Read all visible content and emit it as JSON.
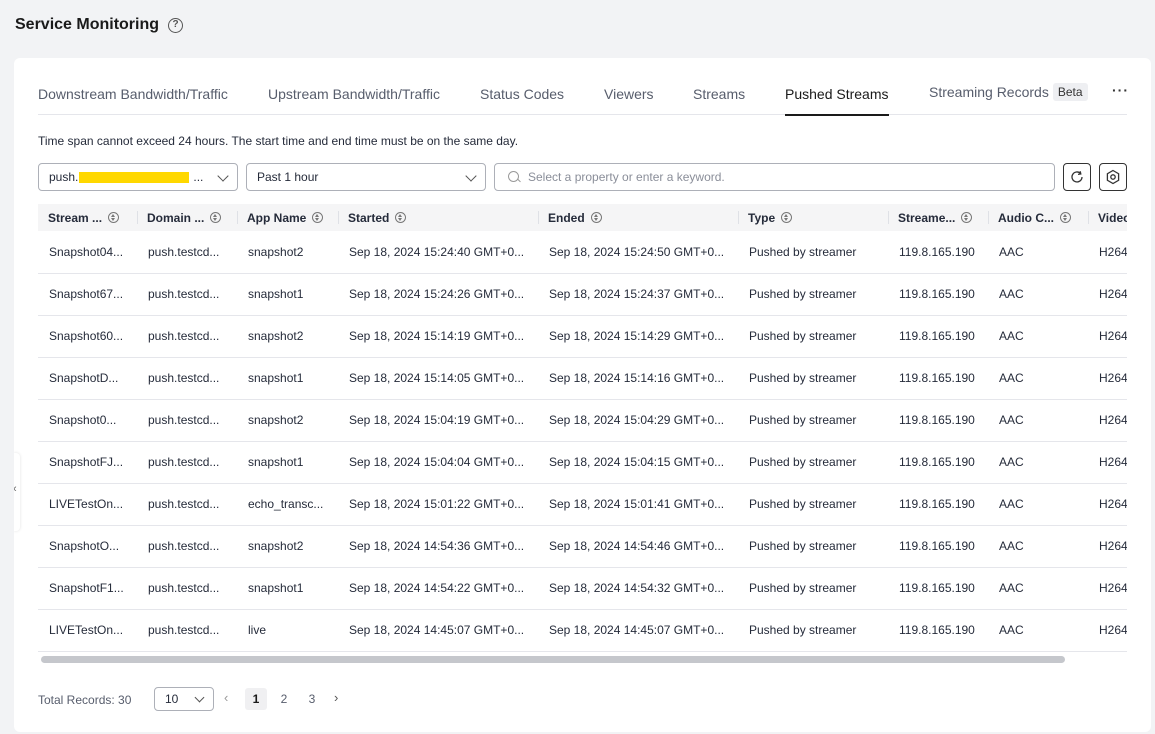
{
  "header": {
    "title": "Service Monitoring"
  },
  "tabs": [
    {
      "label": "Downstream Bandwidth/Traffic"
    },
    {
      "label": "Upstream Bandwidth/Traffic"
    },
    {
      "label": "Status Codes"
    },
    {
      "label": "Viewers"
    },
    {
      "label": "Streams"
    },
    {
      "label": "Pushed Streams",
      "active": true
    },
    {
      "label": "Streaming Records",
      "badge": "Beta"
    }
  ],
  "more_label": "···",
  "notice": "Time span cannot exceed 24 hours. The start time and end time must be on the same day.",
  "filters": {
    "domain_prefix": "push.",
    "domain_suffix": "...",
    "time_range": "Past 1 hour",
    "search_placeholder": "Select a property or enter a keyword."
  },
  "table": {
    "columns": [
      "Stream ...",
      "Domain ...",
      "App Name",
      "Started",
      "Ended",
      "Type",
      "Streame...",
      "Audio C...",
      "Video"
    ],
    "rows": [
      [
        "Snapshot04...",
        "push.testcd...",
        "snapshot2",
        "Sep 18, 2024 15:24:40 GMT+0...",
        "Sep 18, 2024 15:24:50 GMT+0...",
        "Pushed by streamer",
        "119.8.165.190",
        "AAC",
        "H264"
      ],
      [
        "Snapshot67...",
        "push.testcd...",
        "snapshot1",
        "Sep 18, 2024 15:24:26 GMT+0...",
        "Sep 18, 2024 15:24:37 GMT+0...",
        "Pushed by streamer",
        "119.8.165.190",
        "AAC",
        "H264"
      ],
      [
        "Snapshot60...",
        "push.testcd...",
        "snapshot2",
        "Sep 18, 2024 15:14:19 GMT+0...",
        "Sep 18, 2024 15:14:29 GMT+0...",
        "Pushed by streamer",
        "119.8.165.190",
        "AAC",
        "H264"
      ],
      [
        "SnapshotD...",
        "push.testcd...",
        "snapshot1",
        "Sep 18, 2024 15:14:05 GMT+0...",
        "Sep 18, 2024 15:14:16 GMT+0...",
        "Pushed by streamer",
        "119.8.165.190",
        "AAC",
        "H264"
      ],
      [
        "Snapshot0...",
        "push.testcd...",
        "snapshot2",
        "Sep 18, 2024 15:04:19 GMT+0...",
        "Sep 18, 2024 15:04:29 GMT+0...",
        "Pushed by streamer",
        "119.8.165.190",
        "AAC",
        "H264"
      ],
      [
        "SnapshotFJ...",
        "push.testcd...",
        "snapshot1",
        "Sep 18, 2024 15:04:04 GMT+0...",
        "Sep 18, 2024 15:04:15 GMT+0...",
        "Pushed by streamer",
        "119.8.165.190",
        "AAC",
        "H264"
      ],
      [
        "LIVETestOn...",
        "push.testcd...",
        "echo_transc...",
        "Sep 18, 2024 15:01:22 GMT+0...",
        "Sep 18, 2024 15:01:41 GMT+0...",
        "Pushed by streamer",
        "119.8.165.190",
        "AAC",
        "H264"
      ],
      [
        "SnapshotO...",
        "push.testcd...",
        "snapshot2",
        "Sep 18, 2024 14:54:36 GMT+0...",
        "Sep 18, 2024 14:54:46 GMT+0...",
        "Pushed by streamer",
        "119.8.165.190",
        "AAC",
        "H264"
      ],
      [
        "SnapshotF1...",
        "push.testcd...",
        "snapshot1",
        "Sep 18, 2024 14:54:22 GMT+0...",
        "Sep 18, 2024 14:54:32 GMT+0...",
        "Pushed by streamer",
        "119.8.165.190",
        "AAC",
        "H264"
      ],
      [
        "LIVETestOn...",
        "push.testcd...",
        "live",
        "Sep 18, 2024 14:45:07 GMT+0...",
        "Sep 18, 2024 14:45:07 GMT+0...",
        "Pushed by streamer",
        "119.8.165.190",
        "AAC",
        "H264"
      ]
    ]
  },
  "pagination": {
    "total_label": "Total Records: 30",
    "page_size": "10",
    "pages": [
      "1",
      "2",
      "3"
    ],
    "current_page": "1",
    "prev_glyph": "‹",
    "next_glyph": "›"
  },
  "icons": {
    "help": "help-circle-icon",
    "refresh": "refresh-icon",
    "settings": "gear-icon",
    "search": "search-icon"
  },
  "colors": {
    "text": "#252b3a",
    "active_tab_underline": "#1a1a1a",
    "redaction": "#ffd800",
    "page_bg": "#f2f3f5"
  }
}
